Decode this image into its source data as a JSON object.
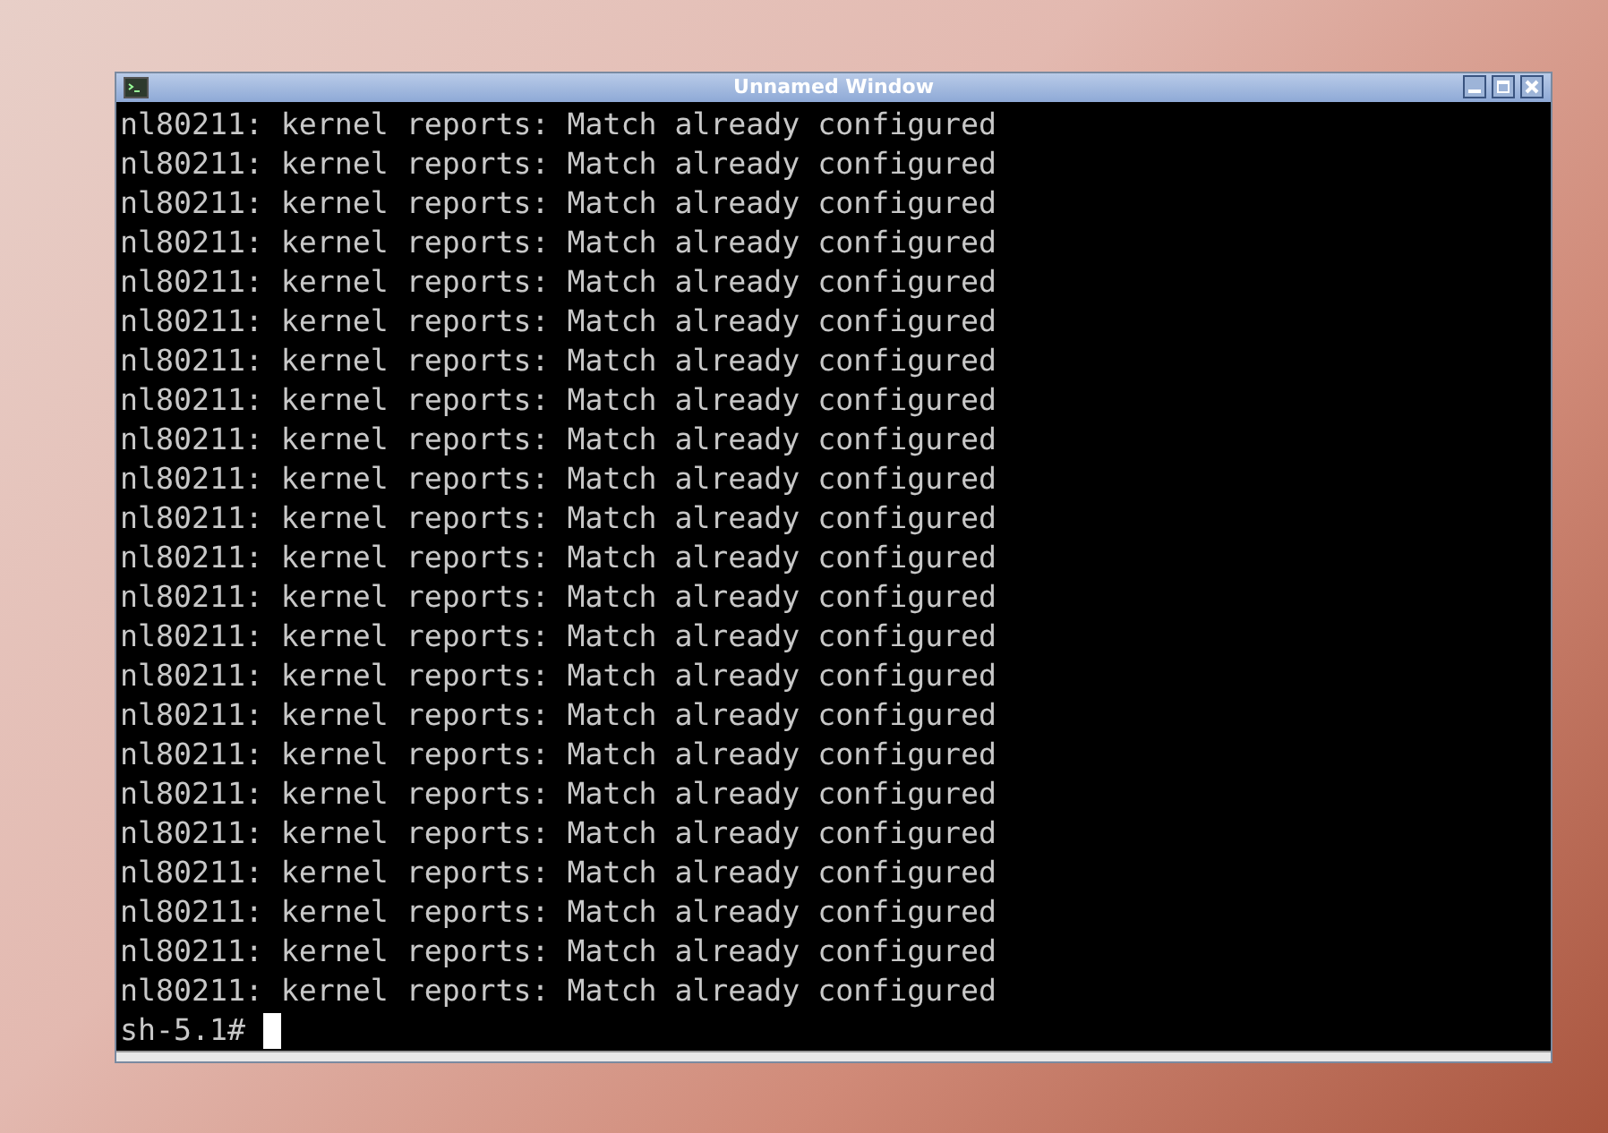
{
  "window": {
    "title": "Unnamed Window"
  },
  "terminal": {
    "lines": [
      "nl80211: kernel reports: Match already configured",
      "nl80211: kernel reports: Match already configured",
      "nl80211: kernel reports: Match already configured",
      "nl80211: kernel reports: Match already configured",
      "nl80211: kernel reports: Match already configured",
      "nl80211: kernel reports: Match already configured",
      "nl80211: kernel reports: Match already configured",
      "nl80211: kernel reports: Match already configured",
      "nl80211: kernel reports: Match already configured",
      "nl80211: kernel reports: Match already configured",
      "nl80211: kernel reports: Match already configured",
      "nl80211: kernel reports: Match already configured",
      "nl80211: kernel reports: Match already configured",
      "nl80211: kernel reports: Match already configured",
      "nl80211: kernel reports: Match already configured",
      "nl80211: kernel reports: Match already configured",
      "nl80211: kernel reports: Match already configured",
      "nl80211: kernel reports: Match already configured",
      "nl80211: kernel reports: Match already configured",
      "nl80211: kernel reports: Match already configured",
      "nl80211: kernel reports: Match already configured",
      "nl80211: kernel reports: Match already configured",
      "nl80211: kernel reports: Match already configured"
    ],
    "prompt": "sh-5.1#"
  }
}
